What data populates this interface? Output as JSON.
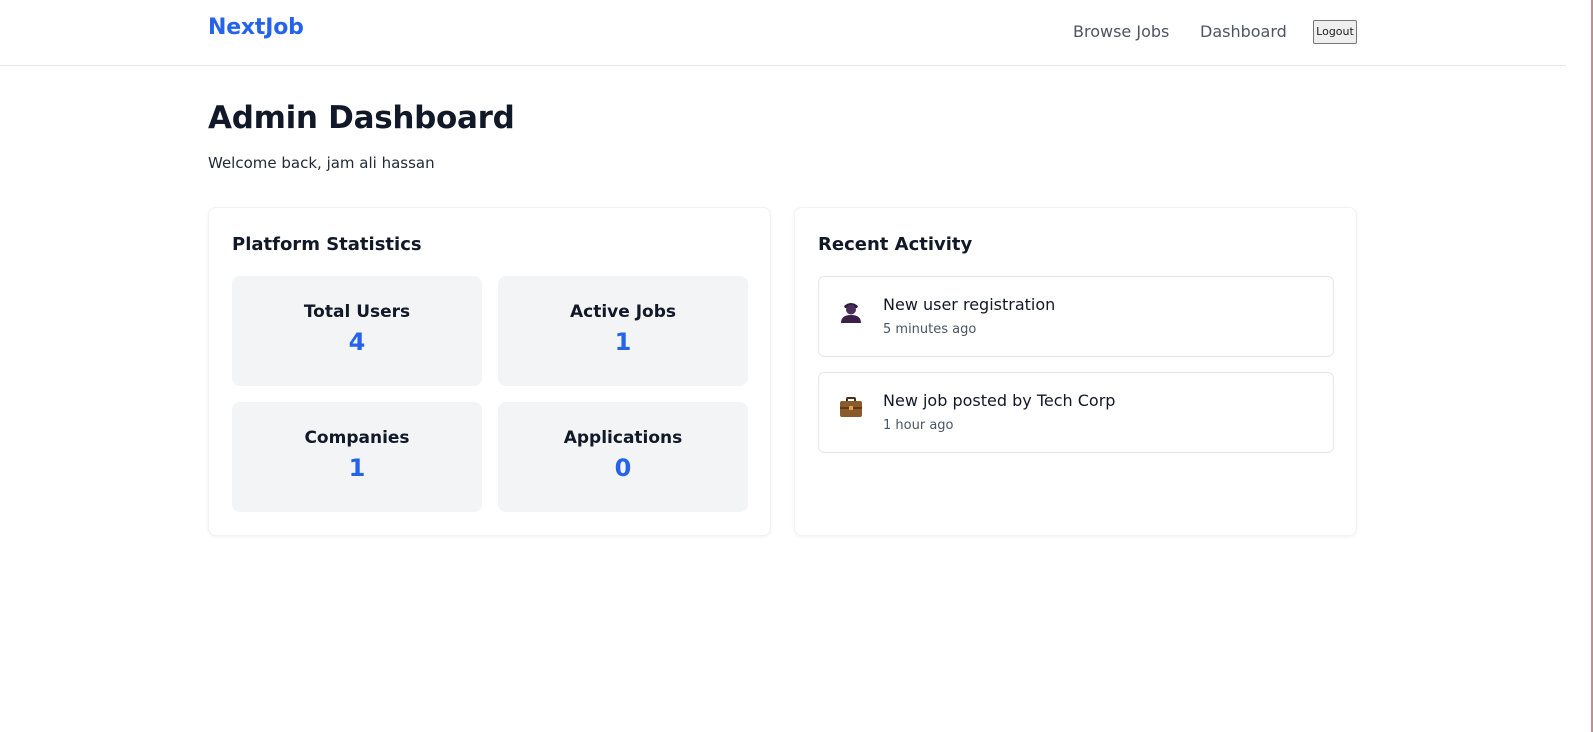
{
  "header": {
    "brand": "NextJob",
    "nav": {
      "browse_jobs": "Browse Jobs",
      "dashboard": "Dashboard"
    },
    "logout_label": "Logout"
  },
  "page": {
    "title": "Admin Dashboard",
    "welcome": "Welcome back, jam ali hassan"
  },
  "stats": {
    "title": "Platform Statistics",
    "items": [
      {
        "label": "Total Users",
        "value": "4"
      },
      {
        "label": "Active Jobs",
        "value": "1"
      },
      {
        "label": "Companies",
        "value": "1"
      },
      {
        "label": "Applications",
        "value": "0"
      }
    ]
  },
  "activity": {
    "title": "Recent Activity",
    "items": [
      {
        "icon": "user-icon",
        "text": "New user registration",
        "time": "5 minutes ago"
      },
      {
        "icon": "briefcase-icon",
        "text": "New job posted by Tech Corp",
        "time": "1 hour ago"
      }
    ]
  },
  "colors": {
    "brand": "#2563eb",
    "stat_tile_bg": "#f3f4f6",
    "text_primary": "#111827",
    "text_secondary": "#4b5563",
    "border": "#e5e7eb"
  }
}
